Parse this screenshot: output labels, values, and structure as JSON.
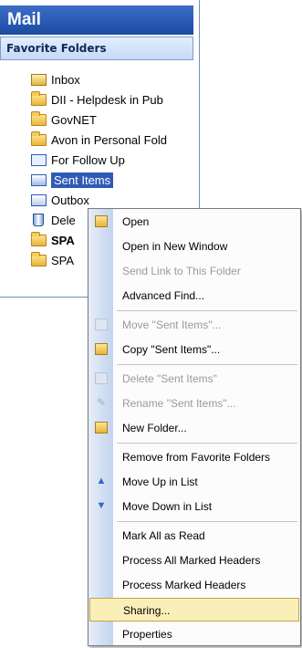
{
  "pane": {
    "title": "Mail",
    "favorite_header": "Favorite Folders",
    "folders": [
      {
        "label": "Inbox",
        "icon": "inbox-icon"
      },
      {
        "label": "DII - Helpdesk in Pub",
        "icon": "folder-icon"
      },
      {
        "label": "GovNET",
        "icon": "folder-icon"
      },
      {
        "label": "Avon in Personal Fold",
        "icon": "folder-icon"
      },
      {
        "label": "For Follow Up",
        "icon": "search-folder-icon"
      },
      {
        "label": "Sent Items",
        "icon": "sent-items-icon",
        "selected": true
      },
      {
        "label": "Outbox",
        "icon": "outbox-icon"
      },
      {
        "label": "Dele",
        "icon": "deleted-items-icon"
      },
      {
        "label": "SPA",
        "icon": "folder-icon",
        "bold": true
      },
      {
        "label": "SPA",
        "icon": "folder-icon"
      }
    ]
  },
  "context_menu": {
    "items": [
      {
        "label": "Open",
        "icon": "open-folder-icon",
        "enabled": true
      },
      {
        "label": "Open in New Window",
        "enabled": true
      },
      {
        "label": "Send Link to This Folder",
        "enabled": false
      },
      {
        "label": "Advanced Find...",
        "enabled": true
      },
      {
        "label": "Move \"Sent Items\"...",
        "icon": "move-icon",
        "enabled": false
      },
      {
        "label": "Copy \"Sent Items\"...",
        "icon": "copy-icon",
        "enabled": true
      },
      {
        "label": "Delete \"Sent Items\"",
        "icon": "delete-icon",
        "enabled": false
      },
      {
        "label": "Rename \"Sent Items\"...",
        "icon": "rename-icon",
        "enabled": false
      },
      {
        "label": "New Folder...",
        "icon": "new-folder-icon",
        "enabled": true
      },
      {
        "label": "Remove from Favorite Folders",
        "enabled": true
      },
      {
        "label": "Move Up in List",
        "icon": "up-arrow-icon",
        "enabled": true
      },
      {
        "label": "Move Down in List",
        "icon": "down-arrow-icon",
        "enabled": true
      },
      {
        "label": "Mark All as Read",
        "enabled": true
      },
      {
        "label": "Process All Marked Headers",
        "enabled": true
      },
      {
        "label": "Process Marked Headers",
        "enabled": true
      },
      {
        "label": "Sharing...",
        "enabled": true,
        "highlighted": true
      },
      {
        "label": "Properties",
        "enabled": true
      }
    ]
  },
  "colors": {
    "title_bar": "#1c4aa0",
    "selection": "#2f5bb5",
    "menu_highlight": "#fbefb9"
  }
}
